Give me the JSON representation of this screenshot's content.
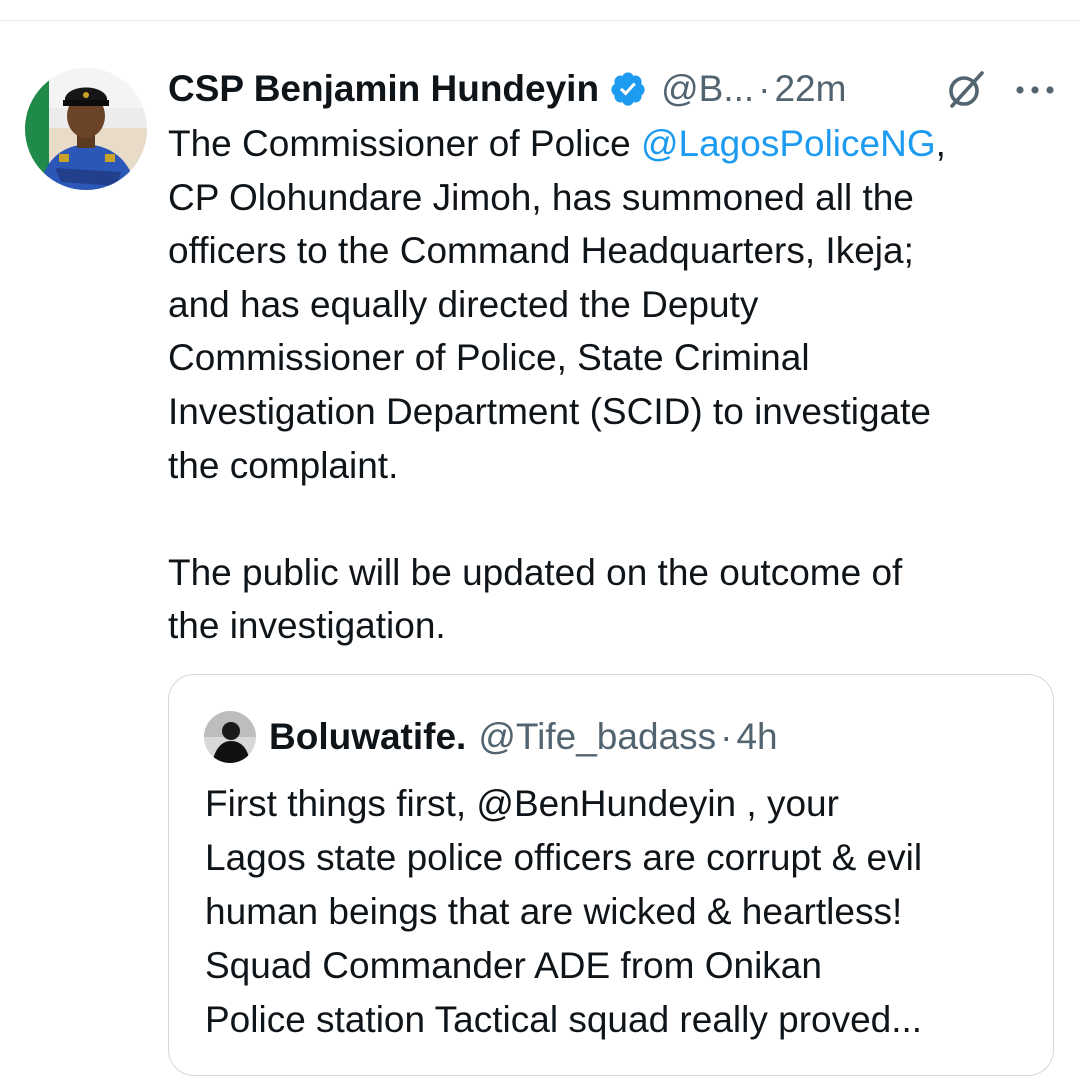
{
  "tweet": {
    "display_name": "CSP Benjamin Hundeyin",
    "handle": "@B...",
    "separator": "·",
    "time": "22m",
    "text_part1": "The Commissioner of Police ",
    "mention": "@LagosPoliceNG",
    "text_part2": ",\nCP Olohundare Jimoh, has summoned all the\nofficers to the Command Headquarters, Ikeja;\nand has equally directed the Deputy\nCommissioner of Police, State Criminal\nInvestigation Department (SCID) to investigate\nthe complaint.\n\nThe public will be updated on the outcome of\nthe investigation.",
    "icons": {
      "verified": "verified-badge-icon",
      "grok": "grok-icon",
      "more": "more-icon"
    }
  },
  "quote": {
    "display_name": "Boluwatife.",
    "handle": "@Tife_badass",
    "separator": "·",
    "time": "4h",
    "text_part1": "First things first, ",
    "mention": "@BenHundeyin",
    "text_part2": " , your\nLagos state police officers are corrupt & evil\nhuman beings that are wicked & heartless!\nSquad Commander ADE from Onikan\nPolice station Tactical squad really proved..."
  },
  "colors": {
    "text": "#0f1419",
    "secondary": "#536471",
    "link": "#1d9bf0",
    "verified": "#1d9bf0",
    "border": "#cfd9de"
  }
}
